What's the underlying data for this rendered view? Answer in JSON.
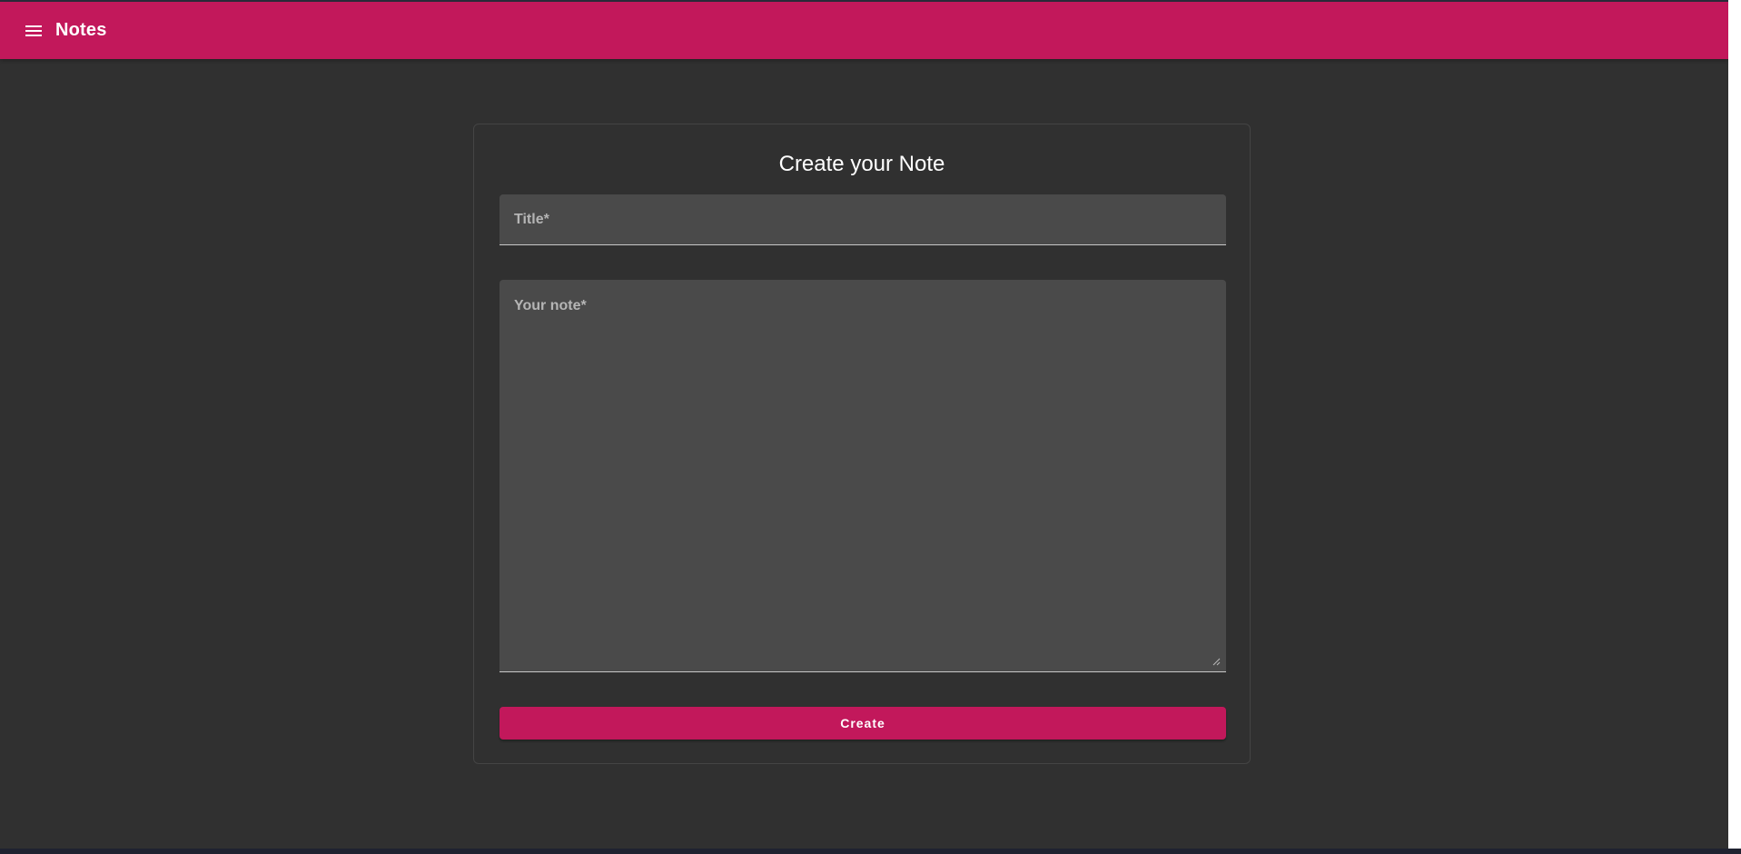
{
  "app_bar": {
    "menu_icon": "menu-icon",
    "title": "Notes"
  },
  "form": {
    "heading": "Create your Note",
    "title_field": {
      "placeholder": "Title*",
      "value": ""
    },
    "note_field": {
      "placeholder": "Your note*",
      "value": ""
    },
    "submit_label": "Create"
  },
  "colors": {
    "primary": "#c2185b",
    "background": "#303030",
    "field_background": "#4a4a4a"
  }
}
